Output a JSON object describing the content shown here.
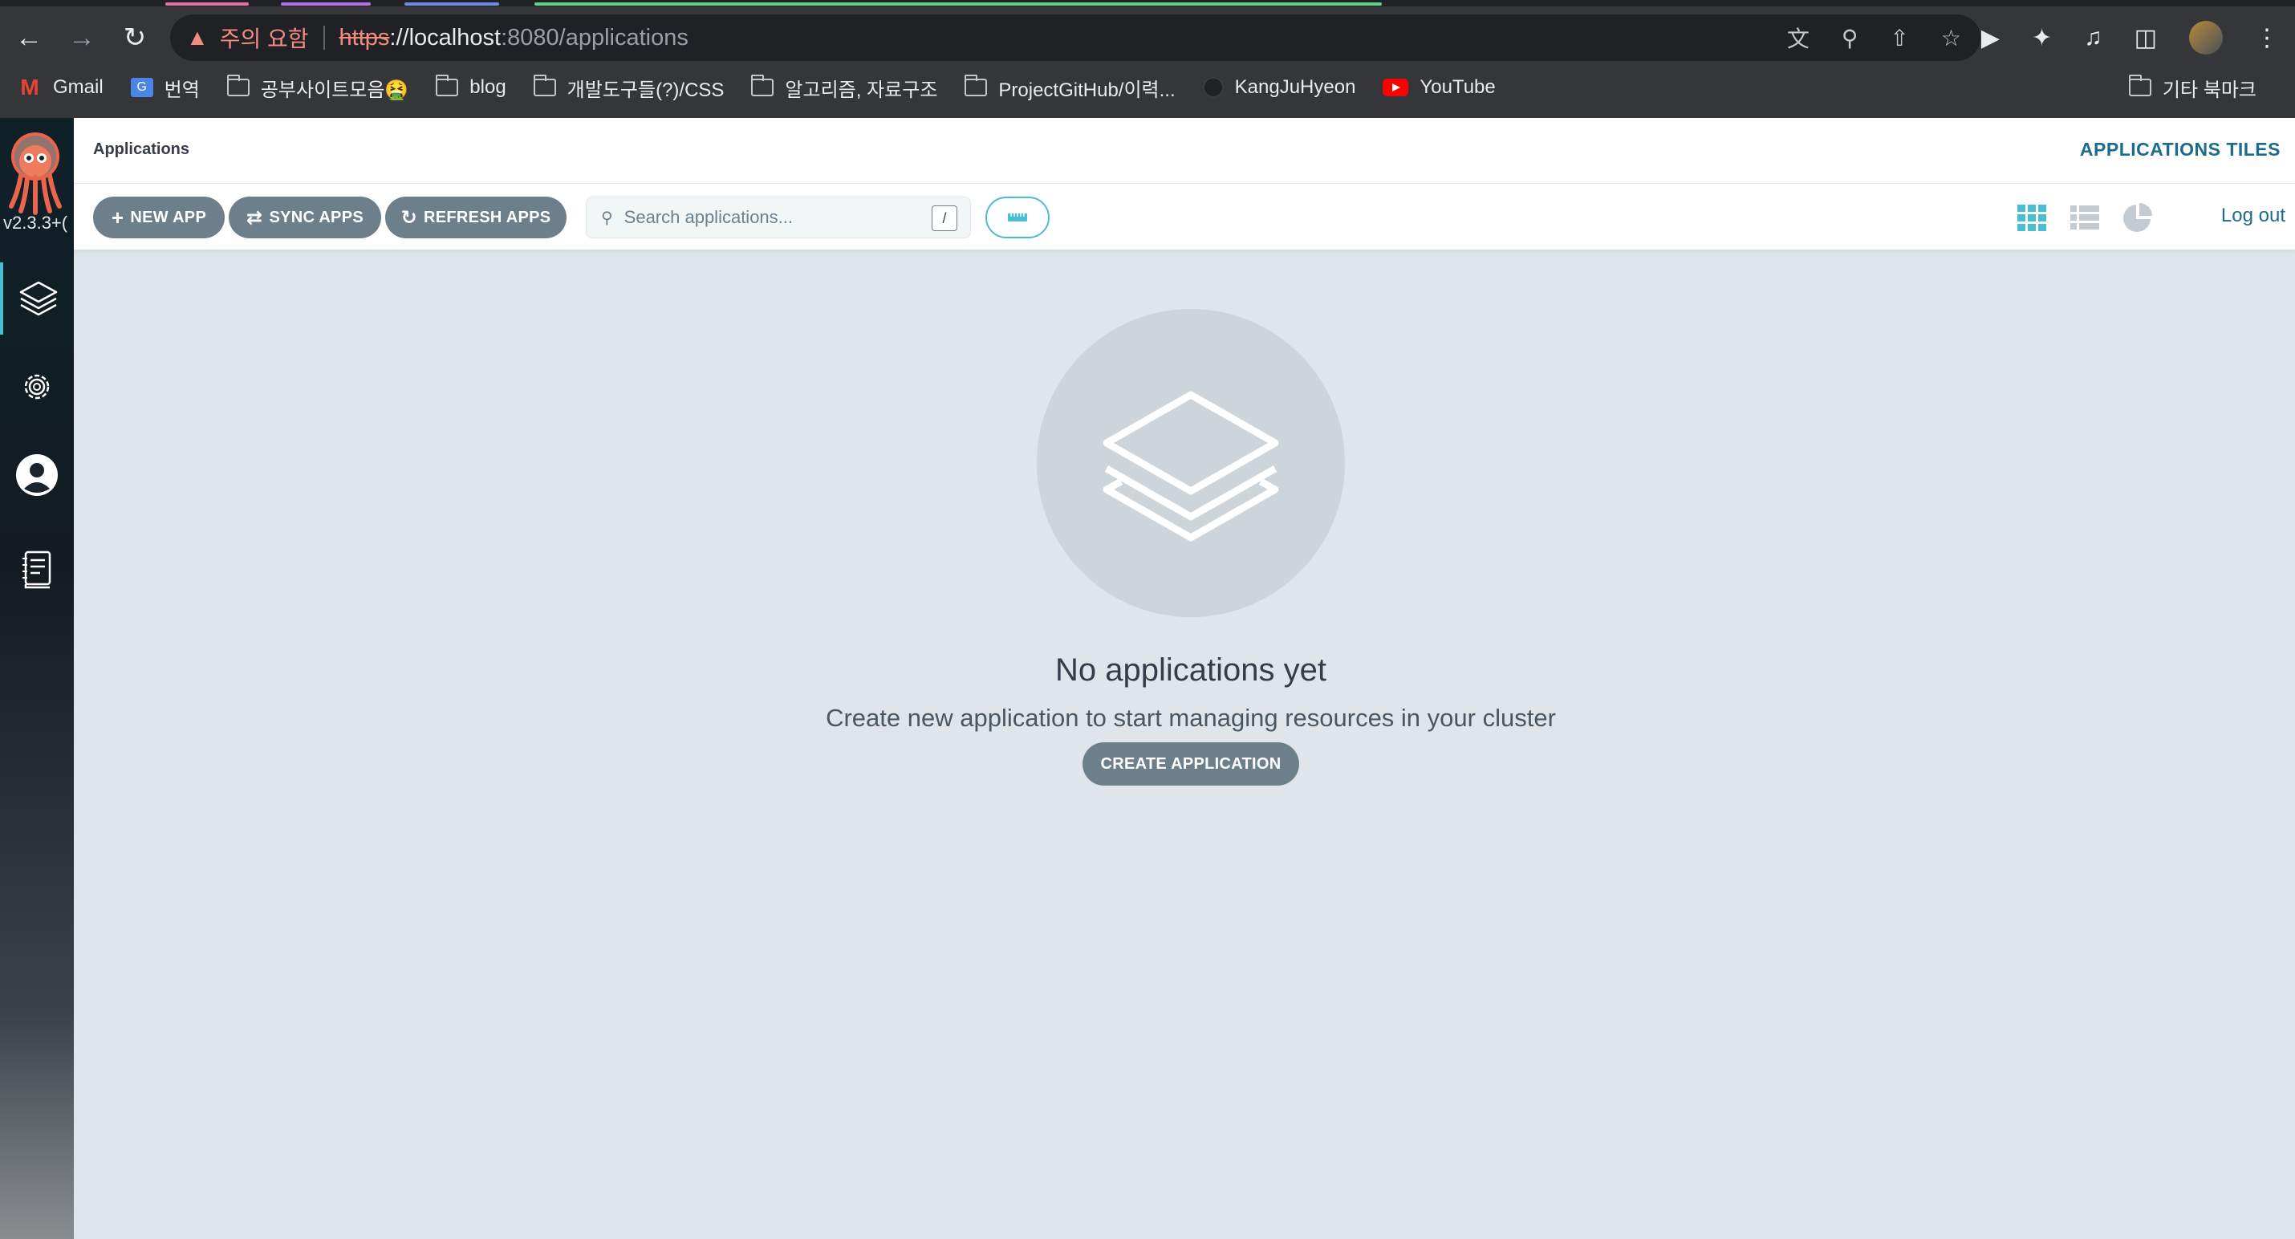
{
  "browser": {
    "warning_label": "주의 요함",
    "url_scheme": "https",
    "url_rest": "://localhost",
    "url_path": ":8080/applications",
    "tab_colors": [
      "#e86fa6",
      "#b46fe8",
      "#6f8be8",
      "#5fd18b"
    ]
  },
  "bookmarks": {
    "items": [
      {
        "label": "Gmail",
        "icon": "gmail-icon"
      },
      {
        "label": "번역",
        "icon": "translate-icon"
      },
      {
        "label": "공부사이트모음🤮",
        "icon": "folder-icon"
      },
      {
        "label": "blog",
        "icon": "folder-icon"
      },
      {
        "label": "개발도구들(?)/CSS",
        "icon": "folder-icon"
      },
      {
        "label": "알고리즘, 자료구조",
        "icon": "folder-icon"
      },
      {
        "label": "ProjectGitHub/이력...",
        "icon": "folder-icon"
      },
      {
        "label": "KangJuHyeon",
        "icon": "github-icon"
      },
      {
        "label": "YouTube",
        "icon": "youtube-icon"
      }
    ],
    "other": "기타 북마크"
  },
  "sidebar": {
    "version": "v2.3.3+(",
    "items": [
      {
        "name": "applications",
        "icon": "layers-icon",
        "active": true
      },
      {
        "name": "settings",
        "icon": "gear-icon",
        "active": false
      },
      {
        "name": "user-info",
        "icon": "user-icon",
        "active": false
      },
      {
        "name": "documentation",
        "icon": "docs-icon",
        "active": false
      }
    ]
  },
  "header": {
    "breadcrumb": "Applications",
    "view_title": "APPLICATIONS TILES"
  },
  "toolbar": {
    "new_app": "NEW APP",
    "sync_apps": "SYNC APPS",
    "refresh_apps": "REFRESH APPS",
    "search_placeholder": "Search applications...",
    "search_shortcut": "/",
    "logout": "Log out"
  },
  "empty_state": {
    "title": "No applications yet",
    "subtitle": "Create new application to start managing resources in your cluster",
    "cta": "CREATE APPLICATION"
  },
  "colors": {
    "accent": "#4bbcd1",
    "button": "#6d7f8b",
    "link": "#1d6b8c",
    "background": "#dee6eb"
  }
}
